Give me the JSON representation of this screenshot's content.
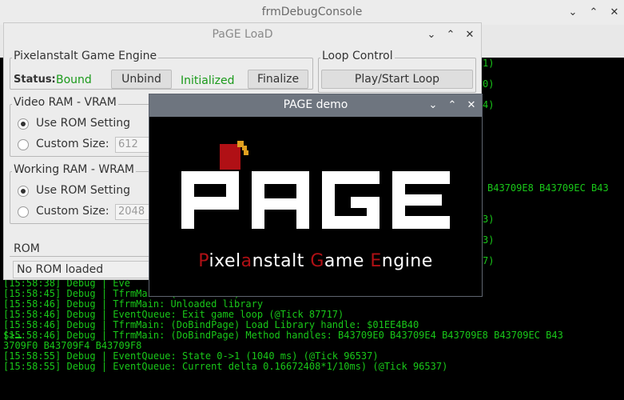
{
  "debug_window": {
    "title": "frmDebugConsole",
    "console_partial_right": [
      "1)",
      "0)",
      "4)",
      "B43709E8 B43709EC B43",
      "3)",
      "3)",
      "7)"
    ],
    "console_lines": [
      "[15:58:38] Debug | Eve",
      "[15:58:45] Debug | TfrmMain: (PAGEThread) Thread terminated",
      "[15:58:46] Debug | TfrmMain: Unloaded library",
      "[15:58:46] Debug | EventQueue: Exit game loop (@Tick 87717)",
      "[15:58:46] Debug | TfrmMain: (DoBindPage) Load Library handle: $01EE4B40",
      "[15:58:46] Debug | TfrmMain: (DoBindPage) Method handles: B43709E0 B43709E4 B43709E8 B43709EC B43",
      "3709F0 B43709F4 B43709F8",
      "[15:58:55] Debug | EventQueue: State 0->1 (1040 ms) (@Tick 96537)",
      "[15:58:55] Debug | EventQueue: Current delta 0.16672408*1/10ms) (@Tick 96537)"
    ],
    "prompt": "$>"
  },
  "load_window": {
    "title": "PaGE LoaD",
    "engine": {
      "label": "Pixelanstalt Game Engine",
      "status_label": "Status:",
      "status_value": "Bound",
      "unbind_button": "Unbind",
      "init_status": "Initialized",
      "finalize_button": "Finalize"
    },
    "loop": {
      "label": "Loop Control",
      "play_button": "Play/Start Loop"
    },
    "vram": {
      "label": "Video RAM - VRAM",
      "option_rom": "Use ROM Setting",
      "option_custom": "Custom Size:",
      "custom_value": "612"
    },
    "wram": {
      "label": "Working RAM - WRAM",
      "option_rom": "Use ROM Setting",
      "option_custom": "Custom Size:",
      "custom_value": "2048"
    },
    "rom": {
      "label": "ROM",
      "value": "No ROM loaded"
    }
  },
  "demo_window": {
    "title": "PAGE demo",
    "logo_text": "PAGE",
    "tagline_parts": [
      "P",
      "ixel",
      "a",
      "nstalt ",
      "G",
      "ame ",
      "E",
      "ngine"
    ]
  },
  "window_controls": {
    "minimize": "⌄",
    "maximize": "⌃",
    "close": "✕"
  }
}
